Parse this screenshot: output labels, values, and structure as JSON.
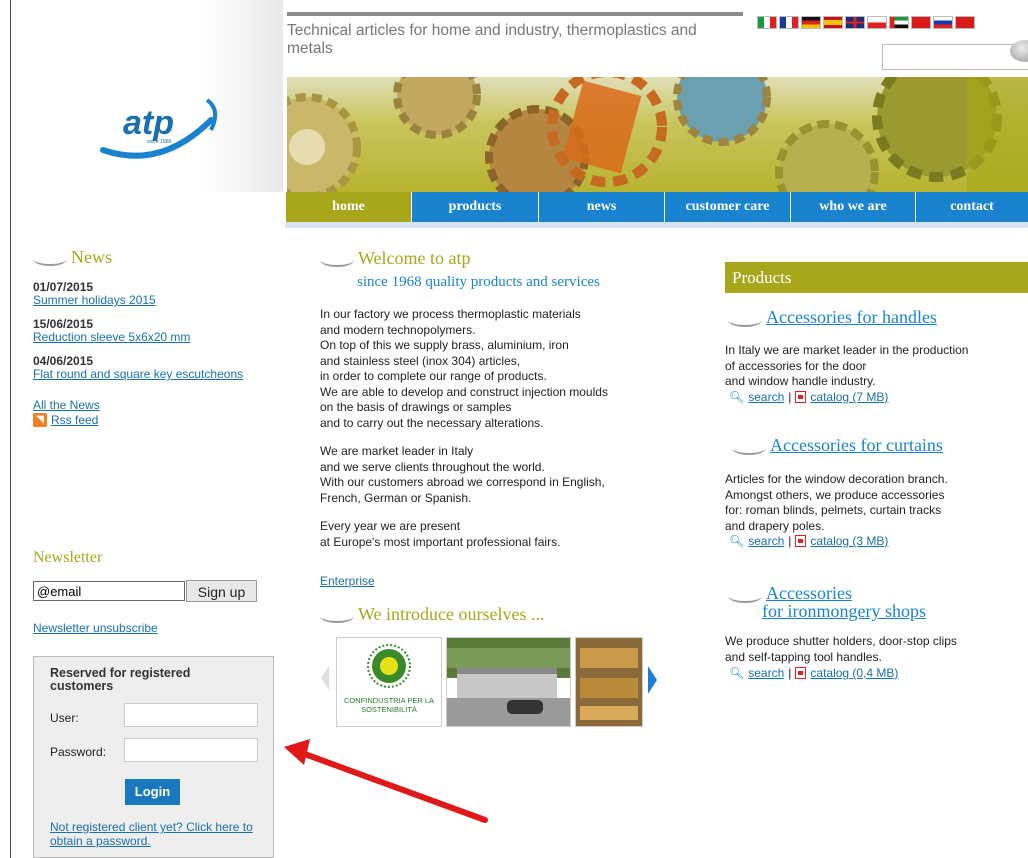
{
  "header": {
    "tagline": "Technical articles for home and industry, thermoplastics and metals",
    "logo_text": "atp",
    "logo_sub": "since 1968",
    "flags": [
      "italian-flag",
      "french-flag",
      "german-flag",
      "spanish-flag",
      "uk-flag",
      "polish-flag",
      "uae-flag",
      "chinese-flag",
      "russian-flag",
      "turkish-flag"
    ]
  },
  "nav": {
    "items": [
      {
        "label": "home",
        "active": true
      },
      {
        "label": "products"
      },
      {
        "label": "news"
      },
      {
        "label": "customer care"
      },
      {
        "label": "who we are"
      },
      {
        "label": "contact"
      }
    ]
  },
  "news": {
    "title": "News",
    "items": [
      {
        "date": "01/07/2015",
        "title": "Summer holidays 2015"
      },
      {
        "date": "15/06/2015",
        "title": "Reduction sleeve 5x6x20 mm"
      },
      {
        "date": "04/06/2015",
        "title": "Flat round and square key escutcheons"
      }
    ],
    "all_news": "All the News",
    "rss": "Rss feed"
  },
  "newsletter": {
    "title": "Newsletter",
    "email_value": "@email",
    "signup_label": "Sign up",
    "unsubscribe": "Newsletter unsubscribe"
  },
  "login": {
    "heading": "Reserved for registered customers",
    "user_label": "User:",
    "password_label": "Password:",
    "login_label": "Login",
    "register_link": "Not registered client yet? Click here to obtain a password."
  },
  "welcome": {
    "title": "Welcome to atp",
    "subtitle": "since 1968 quality products and services",
    "paragraphs": [
      [
        "In our factory we process thermoplastic materials",
        "and modern technopolymers.",
        "On top of this we supply brass, aluminium, iron",
        "and stainless steel (inox 304) articles,",
        "in order to complete our range of products.",
        "We are able to develop and construct injection moulds",
        "on the basis of drawings or samples",
        "and to carry out the necessary alterations."
      ],
      [
        "We are market leader in Italy",
        "and we serve clients throughout the world.",
        "With our customers abroad we correspond in English,",
        "French, German or Spanish."
      ],
      [
        "Every year we are present",
        "at Europe's most important professional fairs."
      ]
    ],
    "enterprise_link": "Enterprise",
    "intro_title": "We introduce ourselves ...",
    "thumb1_text": "CONFINDUSTRIA PER LA SOSTENIBILITÀ"
  },
  "products": {
    "title": "Products",
    "items": [
      {
        "title": "Accessories for handles",
        "body": [
          "In Italy we are market leader in the production",
          "of accessories for the door",
          "and window handle industry."
        ],
        "search": "search",
        "catalog": "catalog (7 MB)"
      },
      {
        "title": "Accessories for curtains",
        "body": [
          "Articles for the window decoration branch.",
          "Amongst others, we produce accessories",
          "for: roman blinds, pelmets, curtain tracks",
          "and drapery poles."
        ],
        "search": "search",
        "catalog": "catalog (3 MB)"
      },
      {
        "title_line1": "Accessories",
        "title_line2": "for ironmongery shops",
        "body": [
          " We produce shutter holders, door-stop clips",
          "and self-tapping tool handles."
        ],
        "search": "search",
        "catalog": "catalog (0,4 MB)"
      }
    ]
  },
  "colors": {
    "olive": "#a8a61a",
    "blue": "#1a83d0",
    "arrow": "#e01818"
  }
}
